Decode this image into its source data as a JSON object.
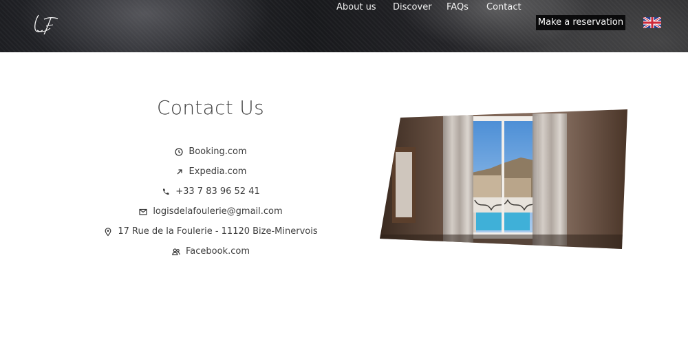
{
  "header": {
    "logo_text": "LF",
    "nav": [
      {
        "label": "About us"
      },
      {
        "label": "Discover"
      },
      {
        "label": "FAQs"
      },
      {
        "label": "Contact"
      }
    ],
    "reservation_label": "Make a reservation",
    "language_flag_icon": "uk-flag-icon"
  },
  "main": {
    "title": "Contact Us",
    "contacts": [
      {
        "icon": "clock-icon",
        "text": "Booking.com"
      },
      {
        "icon": "arrow-up-right-icon",
        "text": "Expedia.com"
      },
      {
        "icon": "phone-icon",
        "text": "+33 7 83 96 52 41"
      },
      {
        "icon": "mail-icon",
        "text": "logisdelafoulerie@gmail.com"
      },
      {
        "icon": "location-pin-icon",
        "text": "17 Rue de la Foulerie - 11120 Bize-Minervois"
      },
      {
        "icon": "people-icon",
        "text": "Facebook.com"
      }
    ],
    "photo": {
      "subject": "room window with curtains overlooking a pool"
    }
  },
  "colors": {
    "header_bg": "#1d1e22",
    "nav_text": "#f2f2f2",
    "reservation_bg": "#0b0b0c",
    "body_text": "#3d3d3d"
  }
}
